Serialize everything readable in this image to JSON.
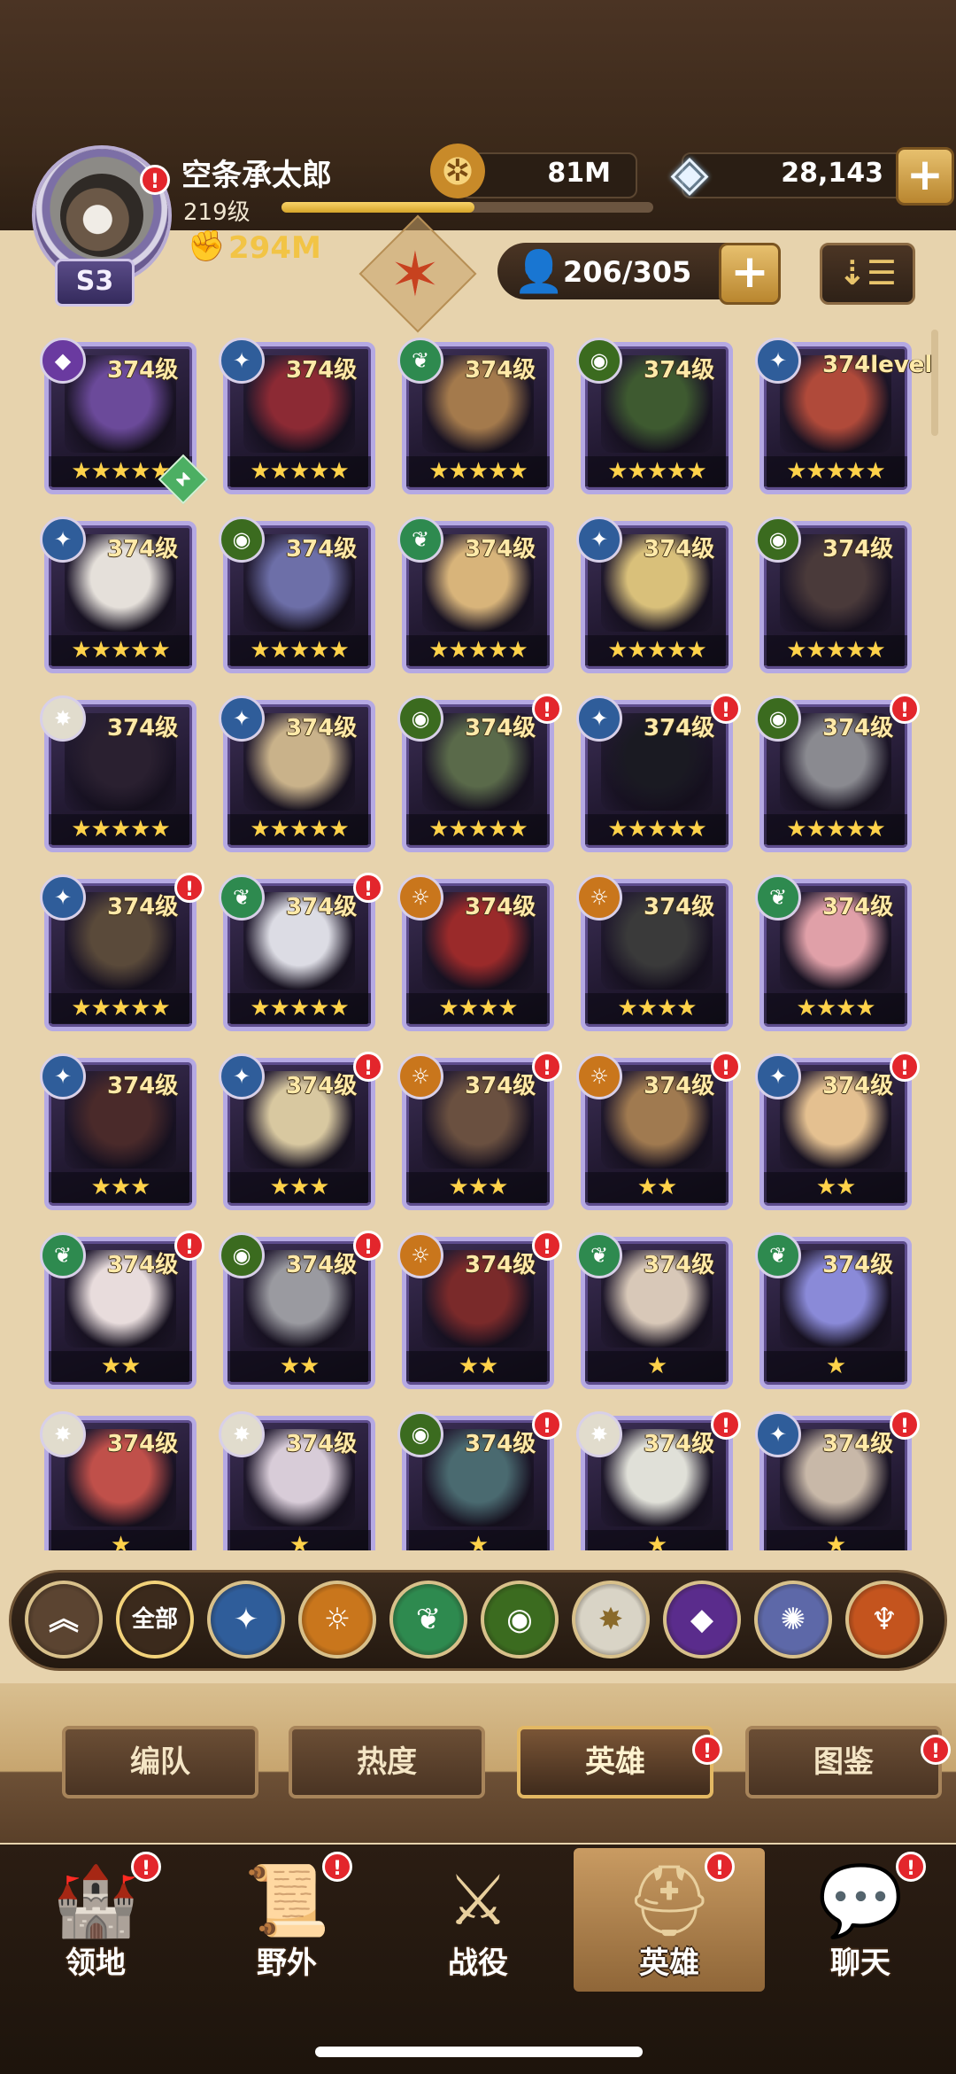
{
  "player": {
    "name": "空条承太郎",
    "level": "219级",
    "rank": "S3",
    "power": "294M",
    "xp_progress": 0.52
  },
  "currency": {
    "gold": "81M",
    "gems": "28,143"
  },
  "roster": {
    "count": "206/305"
  },
  "icons": {
    "alert": "!",
    "plus": "+",
    "sort": "⇣☰",
    "star": "★"
  },
  "heroes": [
    {
      "level": "374级",
      "stars": 5,
      "faction": "graveborn",
      "alert": false,
      "timer": true
    },
    {
      "level": "374级",
      "stars": 5,
      "faction": "lightbearer",
      "alert": false
    },
    {
      "level": "374级",
      "stars": 5,
      "faction": "wilder",
      "alert": false
    },
    {
      "level": "374级",
      "stars": 5,
      "faction": "maulers-eye",
      "alert": false
    },
    {
      "level": "374level",
      "stars": 5,
      "faction": "lightbearer",
      "alert": false
    },
    {
      "level": "374级",
      "stars": 5,
      "faction": "lightbearer",
      "alert": false
    },
    {
      "level": "374级",
      "stars": 5,
      "faction": "maulers-eye",
      "alert": false
    },
    {
      "level": "374级",
      "stars": 5,
      "faction": "wilder",
      "alert": false
    },
    {
      "level": "374级",
      "stars": 5,
      "faction": "lightbearer",
      "alert": false
    },
    {
      "level": "374级",
      "stars": 5,
      "faction": "maulers-eye",
      "alert": false
    },
    {
      "level": "374级",
      "stars": 5,
      "faction": "celestial",
      "alert": false
    },
    {
      "level": "374级",
      "stars": 5,
      "faction": "lightbearer",
      "alert": false
    },
    {
      "level": "374级",
      "stars": 5,
      "faction": "maulers-eye",
      "alert": true
    },
    {
      "level": "374级",
      "stars": 5,
      "faction": "lightbearer",
      "alert": true
    },
    {
      "level": "374级",
      "stars": 5,
      "faction": "maulers-eye",
      "alert": true
    },
    {
      "level": "374级",
      "stars": 5,
      "faction": "lightbearer",
      "alert": true
    },
    {
      "level": "374级",
      "stars": 5,
      "faction": "wilder",
      "alert": true
    },
    {
      "level": "374级",
      "stars": 4,
      "faction": "mauler",
      "alert": false
    },
    {
      "level": "374级",
      "stars": 4,
      "faction": "mauler",
      "alert": false
    },
    {
      "level": "374级",
      "stars": 4,
      "faction": "wilder",
      "alert": false
    },
    {
      "level": "374级",
      "stars": 3,
      "faction": "lightbearer",
      "alert": false
    },
    {
      "level": "374级",
      "stars": 3,
      "faction": "lightbearer",
      "alert": true
    },
    {
      "level": "374级",
      "stars": 3,
      "faction": "mauler",
      "alert": true
    },
    {
      "level": "374级",
      "stars": 2,
      "faction": "mauler",
      "alert": true
    },
    {
      "level": "374级",
      "stars": 2,
      "faction": "lightbearer",
      "alert": true
    },
    {
      "level": "374级",
      "stars": 2,
      "faction": "wilder",
      "alert": true
    },
    {
      "level": "374级",
      "stars": 2,
      "faction": "maulers-eye",
      "alert": true
    },
    {
      "level": "374级",
      "stars": 2,
      "faction": "mauler",
      "alert": true
    },
    {
      "level": "374级",
      "stars": 1,
      "faction": "wilder",
      "alert": false
    },
    {
      "level": "374级",
      "stars": 1,
      "faction": "wilder",
      "alert": false
    },
    {
      "level": "374级",
      "stars": 1,
      "faction": "celestial",
      "alert": false
    },
    {
      "level": "374级",
      "stars": 1,
      "faction": "celestial",
      "alert": false
    },
    {
      "level": "374级",
      "stars": 1,
      "faction": "maulers-eye",
      "alert": true
    },
    {
      "level": "374级",
      "stars": 1,
      "faction": "celestial",
      "alert": true
    },
    {
      "level": "374级",
      "stars": 1,
      "faction": "lightbearer",
      "alert": true
    }
  ],
  "filters": [
    {
      "id": "collapse",
      "label": "︽",
      "color": "#5b4431"
    },
    {
      "id": "all",
      "label": "全部",
      "color": "#3b2a1c"
    },
    {
      "id": "lightbearer",
      "label": "✦",
      "color": "#2f5d9a"
    },
    {
      "id": "mauler",
      "label": "☼",
      "color": "#c9761c"
    },
    {
      "id": "wilder",
      "label": "❦",
      "color": "#2e8a4f"
    },
    {
      "id": "graveborn",
      "label": "◉",
      "color": "#3b6b1f"
    },
    {
      "id": "celestial",
      "label": "✸",
      "color": "#d9d4c6"
    },
    {
      "id": "hypogean",
      "label": "◆",
      "color": "#5a2c8c"
    },
    {
      "id": "dimensional",
      "label": "✺",
      "color": "#5d68a8"
    },
    {
      "id": "dragon",
      "label": "♆",
      "color": "#c4541e"
    }
  ],
  "sub_tabs": [
    "编队",
    "热度",
    "英雄",
    "图鉴"
  ],
  "sub_tab_alerts": [
    false,
    false,
    true,
    true
  ],
  "nav": [
    {
      "label": "领地",
      "icon": "castle-icon",
      "glyph": "🏰",
      "alert": true
    },
    {
      "label": "野外",
      "icon": "scroll-map-icon",
      "glyph": "📜",
      "alert": true
    },
    {
      "label": "战役",
      "icon": "sword-shield-icon",
      "glyph": "⚔",
      "alert": false
    },
    {
      "label": "英雄",
      "icon": "helmet-icon",
      "glyph": "⛑",
      "alert": true
    },
    {
      "label": "聊天",
      "icon": "chat-icon",
      "glyph": "💬",
      "alert": true
    }
  ],
  "colors": {
    "faction": {
      "lightbearer": "#2f5d9a",
      "mauler": "#c9761c",
      "wilder": "#2e8a4f",
      "maulers-eye": "#3b6b1f",
      "graveborn": "#6a3aa0",
      "celestial": "#e1dccd"
    }
  }
}
